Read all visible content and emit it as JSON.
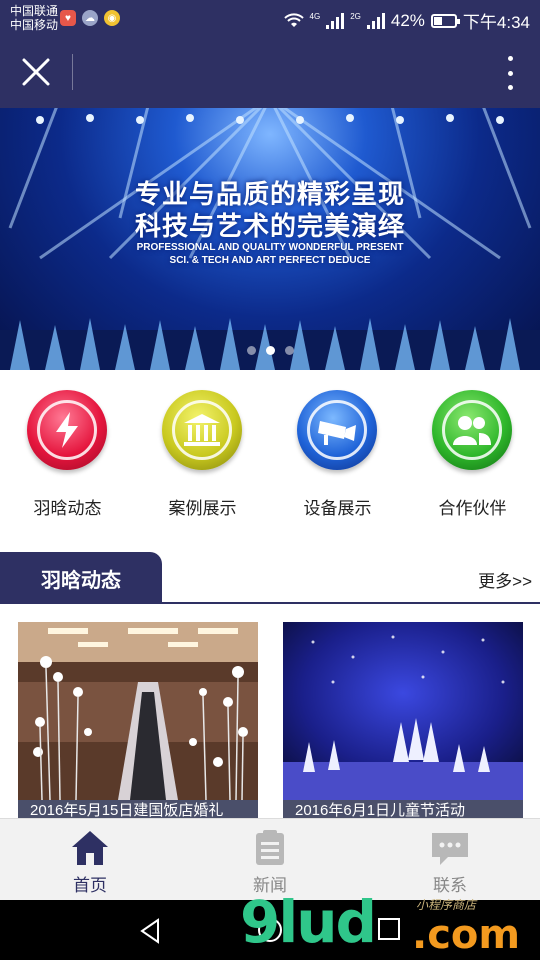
{
  "status_bar": {
    "carrier1": "中国联通",
    "carrier2": "中国移动",
    "network1": "4G",
    "network2": "2G",
    "battery": "42%",
    "battery_level": 0.42,
    "time": "下午4:34"
  },
  "nav_bar": {
    "close_icon": "close-icon",
    "more_icon": "more-vertical-icon"
  },
  "banner": {
    "title_line1": "专业与品质的精彩呈现",
    "title_line2": "科技与艺术的完美演绎",
    "subtitle_line1": "PROFESSIONAL AND QUALITY WONDERFUL PRESENT",
    "subtitle_line2": "SCI. & TECH AND ART PERFECT DEDUCE",
    "slide_count": 3,
    "active_slide": 2
  },
  "quick_menu": [
    {
      "label": "羽晗动态",
      "icon": "lightning-icon",
      "color": "#e5153d"
    },
    {
      "label": "案例展示",
      "icon": "building-icon",
      "color": "#c9c91f"
    },
    {
      "label": "设备展示",
      "icon": "camera-icon",
      "color": "#1f63d8"
    },
    {
      "label": "合作伙伴",
      "icon": "people-icon",
      "color": "#2fb72b"
    }
  ],
  "section": {
    "title": "羽晗动态",
    "more": "更多>>"
  },
  "cards": [
    {
      "caption": "2016年5月15日建国饭店婚礼"
    },
    {
      "caption": "2016年6月1日儿童节活动"
    }
  ],
  "tab_bar": [
    {
      "label": "首页",
      "icon": "home-icon",
      "active": true
    },
    {
      "label": "新闻",
      "icon": "news-icon",
      "active": false
    },
    {
      "label": "联系",
      "icon": "chat-icon",
      "active": false
    }
  ],
  "watermark": {
    "main": "9lud",
    "suffix": ".com",
    "small": "小程序商店"
  },
  "colors": {
    "primary": "#2e3063",
    "tab_active": "#2e3063",
    "tab_inactive": "#888888"
  }
}
